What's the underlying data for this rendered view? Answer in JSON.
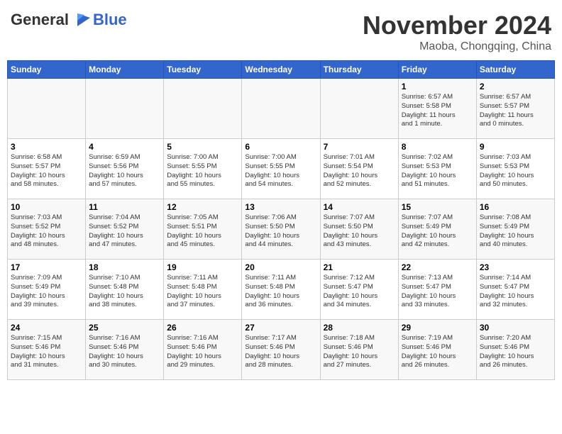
{
  "header": {
    "logo_general": "General",
    "logo_blue": "Blue",
    "month_title": "November 2024",
    "location": "Maoba, Chongqing, China"
  },
  "days_of_week": [
    "Sunday",
    "Monday",
    "Tuesday",
    "Wednesday",
    "Thursday",
    "Friday",
    "Saturday"
  ],
  "weeks": [
    [
      {
        "day": "",
        "info": ""
      },
      {
        "day": "",
        "info": ""
      },
      {
        "day": "",
        "info": ""
      },
      {
        "day": "",
        "info": ""
      },
      {
        "day": "",
        "info": ""
      },
      {
        "day": "1",
        "info": "Sunrise: 6:57 AM\nSunset: 5:58 PM\nDaylight: 11 hours\nand 1 minute."
      },
      {
        "day": "2",
        "info": "Sunrise: 6:57 AM\nSunset: 5:57 PM\nDaylight: 11 hours\nand 0 minutes."
      }
    ],
    [
      {
        "day": "3",
        "info": "Sunrise: 6:58 AM\nSunset: 5:57 PM\nDaylight: 10 hours\nand 58 minutes."
      },
      {
        "day": "4",
        "info": "Sunrise: 6:59 AM\nSunset: 5:56 PM\nDaylight: 10 hours\nand 57 minutes."
      },
      {
        "day": "5",
        "info": "Sunrise: 7:00 AM\nSunset: 5:55 PM\nDaylight: 10 hours\nand 55 minutes."
      },
      {
        "day": "6",
        "info": "Sunrise: 7:00 AM\nSunset: 5:55 PM\nDaylight: 10 hours\nand 54 minutes."
      },
      {
        "day": "7",
        "info": "Sunrise: 7:01 AM\nSunset: 5:54 PM\nDaylight: 10 hours\nand 52 minutes."
      },
      {
        "day": "8",
        "info": "Sunrise: 7:02 AM\nSunset: 5:53 PM\nDaylight: 10 hours\nand 51 minutes."
      },
      {
        "day": "9",
        "info": "Sunrise: 7:03 AM\nSunset: 5:53 PM\nDaylight: 10 hours\nand 50 minutes."
      }
    ],
    [
      {
        "day": "10",
        "info": "Sunrise: 7:03 AM\nSunset: 5:52 PM\nDaylight: 10 hours\nand 48 minutes."
      },
      {
        "day": "11",
        "info": "Sunrise: 7:04 AM\nSunset: 5:52 PM\nDaylight: 10 hours\nand 47 minutes."
      },
      {
        "day": "12",
        "info": "Sunrise: 7:05 AM\nSunset: 5:51 PM\nDaylight: 10 hours\nand 45 minutes."
      },
      {
        "day": "13",
        "info": "Sunrise: 7:06 AM\nSunset: 5:50 PM\nDaylight: 10 hours\nand 44 minutes."
      },
      {
        "day": "14",
        "info": "Sunrise: 7:07 AM\nSunset: 5:50 PM\nDaylight: 10 hours\nand 43 minutes."
      },
      {
        "day": "15",
        "info": "Sunrise: 7:07 AM\nSunset: 5:49 PM\nDaylight: 10 hours\nand 42 minutes."
      },
      {
        "day": "16",
        "info": "Sunrise: 7:08 AM\nSunset: 5:49 PM\nDaylight: 10 hours\nand 40 minutes."
      }
    ],
    [
      {
        "day": "17",
        "info": "Sunrise: 7:09 AM\nSunset: 5:49 PM\nDaylight: 10 hours\nand 39 minutes."
      },
      {
        "day": "18",
        "info": "Sunrise: 7:10 AM\nSunset: 5:48 PM\nDaylight: 10 hours\nand 38 minutes."
      },
      {
        "day": "19",
        "info": "Sunrise: 7:11 AM\nSunset: 5:48 PM\nDaylight: 10 hours\nand 37 minutes."
      },
      {
        "day": "20",
        "info": "Sunrise: 7:11 AM\nSunset: 5:48 PM\nDaylight: 10 hours\nand 36 minutes."
      },
      {
        "day": "21",
        "info": "Sunrise: 7:12 AM\nSunset: 5:47 PM\nDaylight: 10 hours\nand 34 minutes."
      },
      {
        "day": "22",
        "info": "Sunrise: 7:13 AM\nSunset: 5:47 PM\nDaylight: 10 hours\nand 33 minutes."
      },
      {
        "day": "23",
        "info": "Sunrise: 7:14 AM\nSunset: 5:47 PM\nDaylight: 10 hours\nand 32 minutes."
      }
    ],
    [
      {
        "day": "24",
        "info": "Sunrise: 7:15 AM\nSunset: 5:46 PM\nDaylight: 10 hours\nand 31 minutes."
      },
      {
        "day": "25",
        "info": "Sunrise: 7:16 AM\nSunset: 5:46 PM\nDaylight: 10 hours\nand 30 minutes."
      },
      {
        "day": "26",
        "info": "Sunrise: 7:16 AM\nSunset: 5:46 PM\nDaylight: 10 hours\nand 29 minutes."
      },
      {
        "day": "27",
        "info": "Sunrise: 7:17 AM\nSunset: 5:46 PM\nDaylight: 10 hours\nand 28 minutes."
      },
      {
        "day": "28",
        "info": "Sunrise: 7:18 AM\nSunset: 5:46 PM\nDaylight: 10 hours\nand 27 minutes."
      },
      {
        "day": "29",
        "info": "Sunrise: 7:19 AM\nSunset: 5:46 PM\nDaylight: 10 hours\nand 26 minutes."
      },
      {
        "day": "30",
        "info": "Sunrise: 7:20 AM\nSunset: 5:46 PM\nDaylight: 10 hours\nand 26 minutes."
      }
    ]
  ]
}
